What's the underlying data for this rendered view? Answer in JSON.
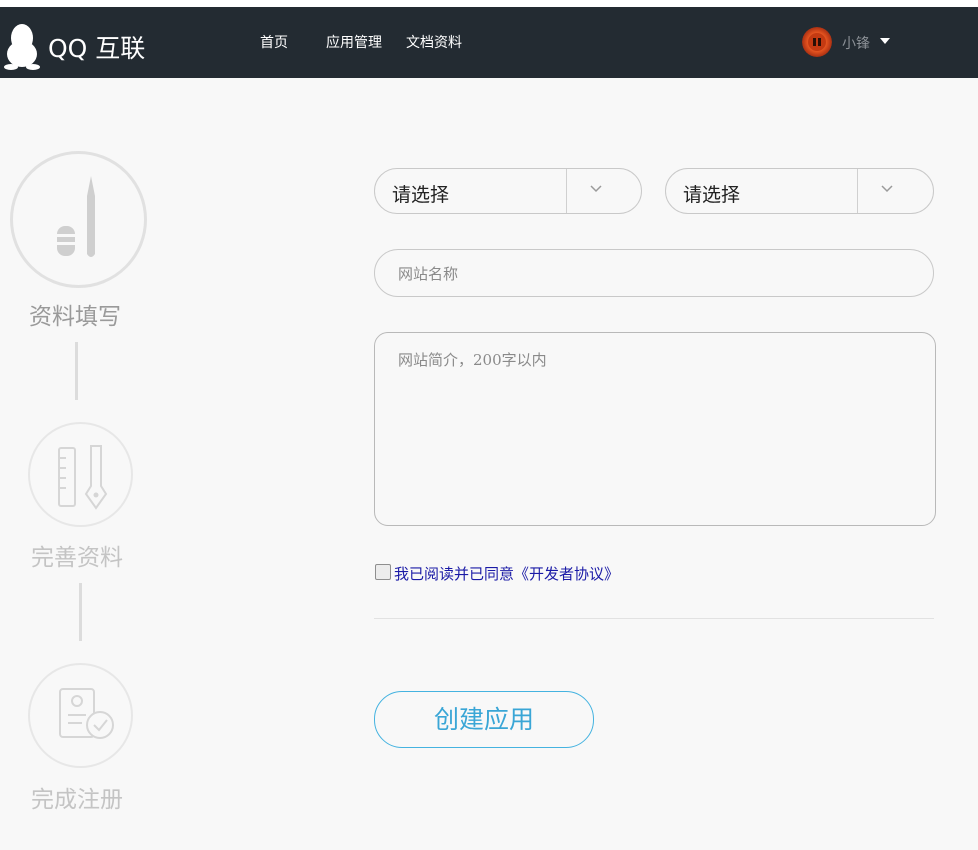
{
  "header": {
    "logo_text": "QQ 互联",
    "nav": [
      {
        "label": "首页"
      },
      {
        "label": "应用管理"
      },
      {
        "label": "文档资料"
      }
    ],
    "user": {
      "name": "小锋"
    }
  },
  "steps": [
    {
      "label": "资料填写",
      "state": "active",
      "icon": "pen-icon"
    },
    {
      "label": "完善资料",
      "state": "inactive",
      "icon": "ruler-pen-icon"
    },
    {
      "label": "完成注册",
      "state": "inactive",
      "icon": "document-check-icon"
    }
  ],
  "form": {
    "select1": {
      "value": "请选择"
    },
    "select2": {
      "value": "请选择"
    },
    "site_name": {
      "value": "",
      "placeholder": "网站名称"
    },
    "site_intro": {
      "value": "",
      "placeholder": "网站简介，200字以内"
    },
    "agree": {
      "checked": false,
      "label": "我已阅读并已同意《开发者协议》"
    },
    "submit_label": "创建应用"
  },
  "colors": {
    "navbar": "#232b32",
    "accent": "#3aa6d6",
    "link": "#1a1aa6",
    "step_active": "#9a9a9a",
    "step_inactive": "#c4c4c4"
  }
}
